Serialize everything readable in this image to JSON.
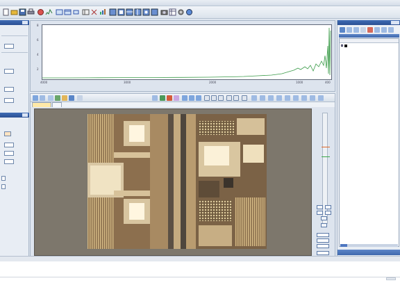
{
  "spectrum": {
    "x_ticks": [
      "4000",
      "3000",
      "2000",
      "1000",
      "400"
    ],
    "y_ticks": [
      "8",
      "6",
      "4",
      "2"
    ],
    "line_color": "#3a9b48"
  },
  "image_view": {
    "tabs": [
      {
        "label": "",
        "active": true
      },
      {
        "label": "",
        "active": false
      }
    ]
  },
  "colors": {
    "panel_header": "#2f5aa0",
    "window_bg": "#dfe6ef",
    "viewer_bg": "#7d776c",
    "tab_active": "#ffe9a8",
    "scale_mark_1": "#e06a2a",
    "scale_mark_2": "#3aa84a"
  },
  "icons": [
    "open-icon",
    "save-icon",
    "print-icon",
    "zoom-icon",
    "select-icon",
    "measure-icon",
    "camera-icon",
    "grid-icon",
    "settings-icon"
  ]
}
